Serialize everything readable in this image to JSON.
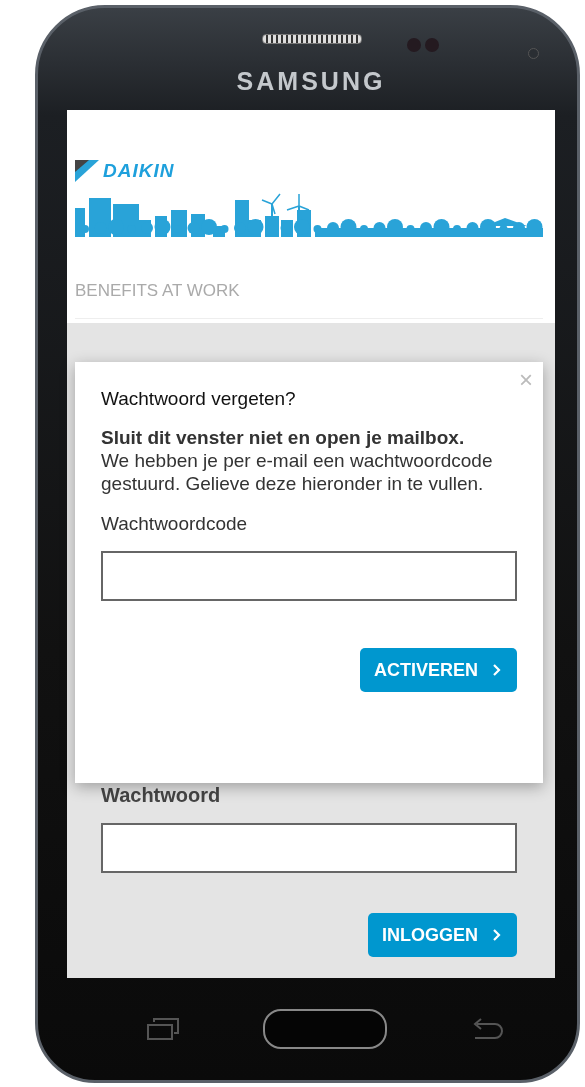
{
  "phone": {
    "brand": "SAMSUNG"
  },
  "header": {
    "logo_text": "DAIKIN",
    "tagline": "BENEFITS AT WORK"
  },
  "login_form": {
    "password_label": "Wachtwoord",
    "submit_button": "INLOGGEN"
  },
  "dialog": {
    "title": "Wachtwoord vergeten?",
    "close": "×",
    "message": "**Sluit dit venster niet en open je mailbox.** We hebben je per e-mail een wachtwoordcode gestuurd. Gelieve deze hieronder in te vullen.",
    "code_label": "Wachtwoordcode",
    "submit_button": "ACTIVEREN"
  }
}
